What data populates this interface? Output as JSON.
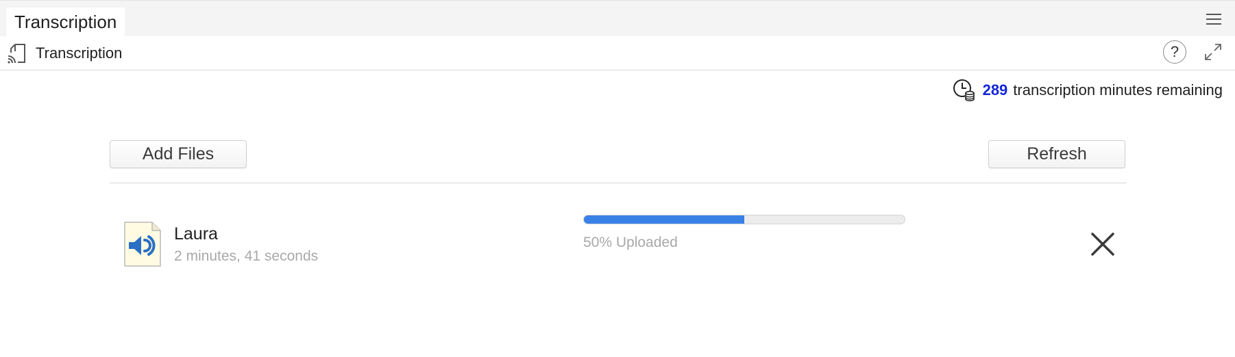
{
  "tab": {
    "label": "Transcription"
  },
  "toolbar": {
    "title": "Transcription",
    "help_label": "?"
  },
  "minutes": {
    "count": "289",
    "label": "transcription minutes remaining"
  },
  "actions": {
    "add_files": "Add Files",
    "refresh": "Refresh"
  },
  "files": [
    {
      "name": "Laura",
      "duration": "2 minutes, 41 seconds",
      "progress": 0.5,
      "progress_label": "50% Uploaded"
    }
  ],
  "colors": {
    "accent": "#1526d8",
    "progress": "#3a81e6",
    "muted_text": "#a8a8a8"
  },
  "icons": {
    "tab_menu": "hamburger-menu-icon",
    "toolbar": "cast-icon",
    "help": "help-icon",
    "expand": "expand-icon",
    "minutes": "clock-coins-icon",
    "file": "audio-file-icon",
    "remove": "close-icon"
  }
}
